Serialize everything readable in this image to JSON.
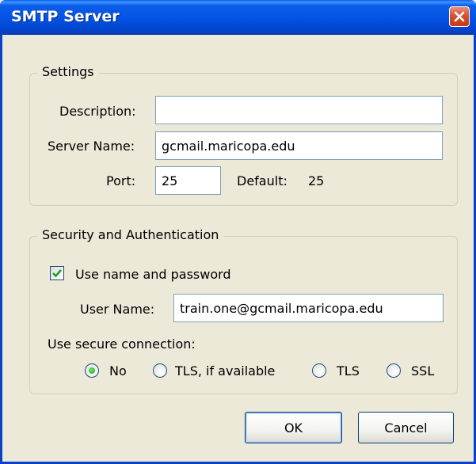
{
  "window": {
    "title": "SMTP Server"
  },
  "settings": {
    "legend": "Settings",
    "description": {
      "label": "Description:",
      "value": ""
    },
    "server_name": {
      "label": "Server Name:",
      "value": "gcmail.maricopa.edu"
    },
    "port": {
      "label": "Port:",
      "value": "25"
    },
    "default": {
      "label": "Default:",
      "value": "25"
    }
  },
  "security": {
    "legend": "Security and Authentication",
    "use_name_password": {
      "label": "Use name and password",
      "checked": true
    },
    "user_name": {
      "label": "User Name:",
      "value": "train.one@gcmail.maricopa.edu"
    },
    "secure_connection_label": "Use secure connection:",
    "options": [
      {
        "label": "No",
        "selected": true
      },
      {
        "label": "TLS, if available",
        "selected": false
      },
      {
        "label": "TLS",
        "selected": false
      },
      {
        "label": "SSL",
        "selected": false
      }
    ]
  },
  "buttons": {
    "ok": "OK",
    "cancel": "Cancel"
  },
  "colors": {
    "titlebar": "#0454e6",
    "close": "#d5512f",
    "face": "#ece9d8",
    "check": "#21a121"
  }
}
